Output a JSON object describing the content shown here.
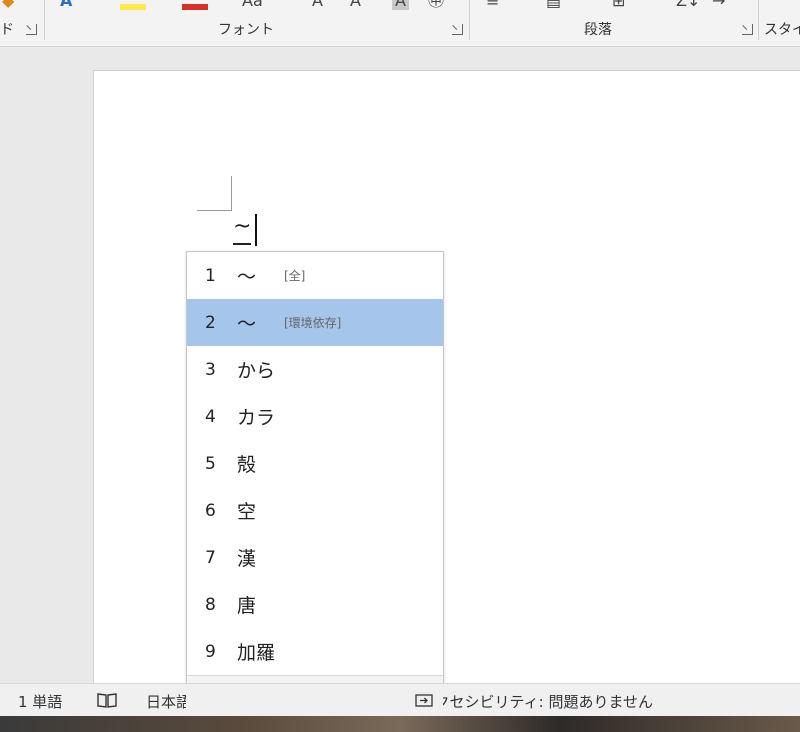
{
  "ribbon": {
    "groups": [
      {
        "label": "ド"
      },
      {
        "label": "フォント"
      },
      {
        "label": "段落"
      },
      {
        "label": "スタイ"
      }
    ]
  },
  "document": {
    "typed_text": "~"
  },
  "candidates": {
    "items": [
      {
        "num": "1",
        "word": "〜",
        "note": "[全]"
      },
      {
        "num": "2",
        "word": "〜",
        "note": "[環境依存]"
      },
      {
        "num": "3",
        "word": "から",
        "note": ""
      },
      {
        "num": "4",
        "word": "カラ",
        "note": ""
      },
      {
        "num": "5",
        "word": "殻",
        "note": ""
      },
      {
        "num": "6",
        "word": "空",
        "note": ""
      },
      {
        "num": "7",
        "word": "漢",
        "note": ""
      },
      {
        "num": "8",
        "word": "唐",
        "note": ""
      },
      {
        "num": "9",
        "word": "加羅",
        "note": ""
      }
    ],
    "selected_index": 2
  },
  "statusbar": {
    "word_count": "1 単語",
    "language": "日本語",
    "accessibility": "アクセシビリティ: 問題ありません"
  },
  "colors": {
    "selected_bg": "#a6c5ea",
    "ribbon_bg": "#f3f3f3"
  }
}
